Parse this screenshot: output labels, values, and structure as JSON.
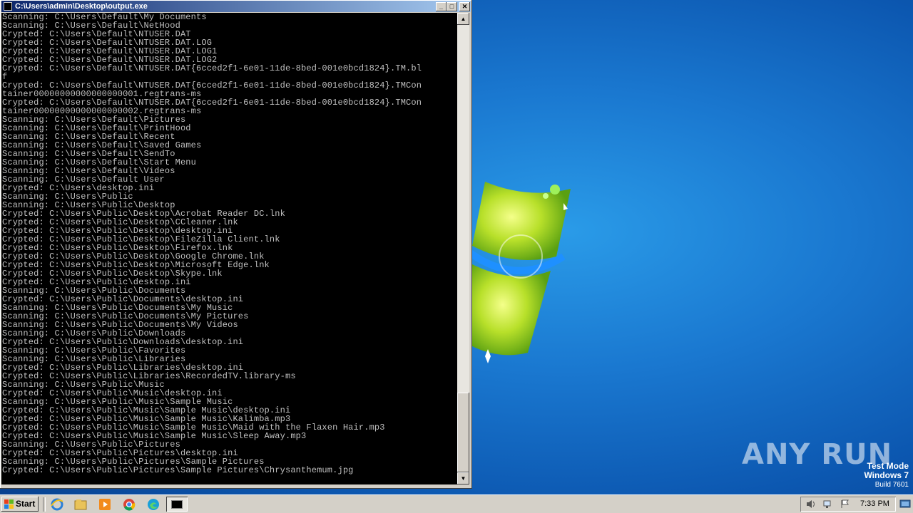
{
  "window": {
    "title": "C:\\Users\\admin\\Desktop\\output.exe",
    "buttons": {
      "minimize": "_",
      "maximize": "□",
      "close": "✕"
    }
  },
  "console": {
    "lines": [
      "Scanning: C:\\Users\\Default\\My Documents",
      "Scanning: C:\\Users\\Default\\NetHood",
      "Crypted: C:\\Users\\Default\\NTUSER.DAT",
      "Crypted: C:\\Users\\Default\\NTUSER.DAT.LOG",
      "Crypted: C:\\Users\\Default\\NTUSER.DAT.LOG1",
      "Crypted: C:\\Users\\Default\\NTUSER.DAT.LOG2",
      "Crypted: C:\\Users\\Default\\NTUSER.DAT{6cced2f1-6e01-11de-8bed-001e0bcd1824}.TM.bl",
      "f",
      "Crypted: C:\\Users\\Default\\NTUSER.DAT{6cced2f1-6e01-11de-8bed-001e0bcd1824}.TMCon",
      "tainer00000000000000000001.regtrans-ms",
      "Crypted: C:\\Users\\Default\\NTUSER.DAT{6cced2f1-6e01-11de-8bed-001e0bcd1824}.TMCon",
      "tainer00000000000000000002.regtrans-ms",
      "Scanning: C:\\Users\\Default\\Pictures",
      "Scanning: C:\\Users\\Default\\PrintHood",
      "Scanning: C:\\Users\\Default\\Recent",
      "Scanning: C:\\Users\\Default\\Saved Games",
      "Scanning: C:\\Users\\Default\\SendTo",
      "Scanning: C:\\Users\\Default\\Start Menu",
      "Scanning: C:\\Users\\Default\\Videos",
      "Scanning: C:\\Users\\Default User",
      "Crypted: C:\\Users\\desktop.ini",
      "Scanning: C:\\Users\\Public",
      "Scanning: C:\\Users\\Public\\Desktop",
      "Crypted: C:\\Users\\Public\\Desktop\\Acrobat Reader DC.lnk",
      "Crypted: C:\\Users\\Public\\Desktop\\CCleaner.lnk",
      "Crypted: C:\\Users\\Public\\Desktop\\desktop.ini",
      "Crypted: C:\\Users\\Public\\Desktop\\FileZilla Client.lnk",
      "Crypted: C:\\Users\\Public\\Desktop\\Firefox.lnk",
      "Crypted: C:\\Users\\Public\\Desktop\\Google Chrome.lnk",
      "Crypted: C:\\Users\\Public\\Desktop\\Microsoft Edge.lnk",
      "Crypted: C:\\Users\\Public\\Desktop\\Skype.lnk",
      "Crypted: C:\\Users\\Public\\desktop.ini",
      "Scanning: C:\\Users\\Public\\Documents",
      "Crypted: C:\\Users\\Public\\Documents\\desktop.ini",
      "Scanning: C:\\Users\\Public\\Documents\\My Music",
      "Scanning: C:\\Users\\Public\\Documents\\My Pictures",
      "Scanning: C:\\Users\\Public\\Documents\\My Videos",
      "Scanning: C:\\Users\\Public\\Downloads",
      "Crypted: C:\\Users\\Public\\Downloads\\desktop.ini",
      "Scanning: C:\\Users\\Public\\Favorites",
      "Scanning: C:\\Users\\Public\\Libraries",
      "Crypted: C:\\Users\\Public\\Libraries\\desktop.ini",
      "Crypted: C:\\Users\\Public\\Libraries\\RecordedTV.library-ms",
      "Scanning: C:\\Users\\Public\\Music",
      "Crypted: C:\\Users\\Public\\Music\\desktop.ini",
      "Scanning: C:\\Users\\Public\\Music\\Sample Music",
      "Crypted: C:\\Users\\Public\\Music\\Sample Music\\desktop.ini",
      "Crypted: C:\\Users\\Public\\Music\\Sample Music\\Kalimba.mp3",
      "Crypted: C:\\Users\\Public\\Music\\Sample Music\\Maid with the Flaxen Hair.mp3",
      "Crypted: C:\\Users\\Public\\Music\\Sample Music\\Sleep Away.mp3",
      "Scanning: C:\\Users\\Public\\Pictures",
      "Crypted: C:\\Users\\Public\\Pictures\\desktop.ini",
      "Scanning: C:\\Users\\Public\\Pictures\\Sample Pictures",
      "Crypted: C:\\Users\\Public\\Pictures\\Sample Pictures\\Chrysanthemum.jpg"
    ]
  },
  "desktop": {
    "watermark": "ANY RUN",
    "test_mode": {
      "line1": "Test Mode",
      "line2": "Windows 7",
      "line3": "Build 7601"
    }
  },
  "taskbar": {
    "start_label": "Start",
    "quick_launch": [
      "ie-icon",
      "explorer-icon",
      "media-player-icon",
      "chrome-icon",
      "edge-icon"
    ],
    "clock": "7:33 PM"
  },
  "colors": {
    "desktop_bg": "#1a78d0",
    "console_bg": "#000000",
    "console_text": "#c0c0c0",
    "titlebar_start": "#0a246a",
    "titlebar_end": "#a6caf0",
    "chrome_gray": "#d4d0c8"
  }
}
